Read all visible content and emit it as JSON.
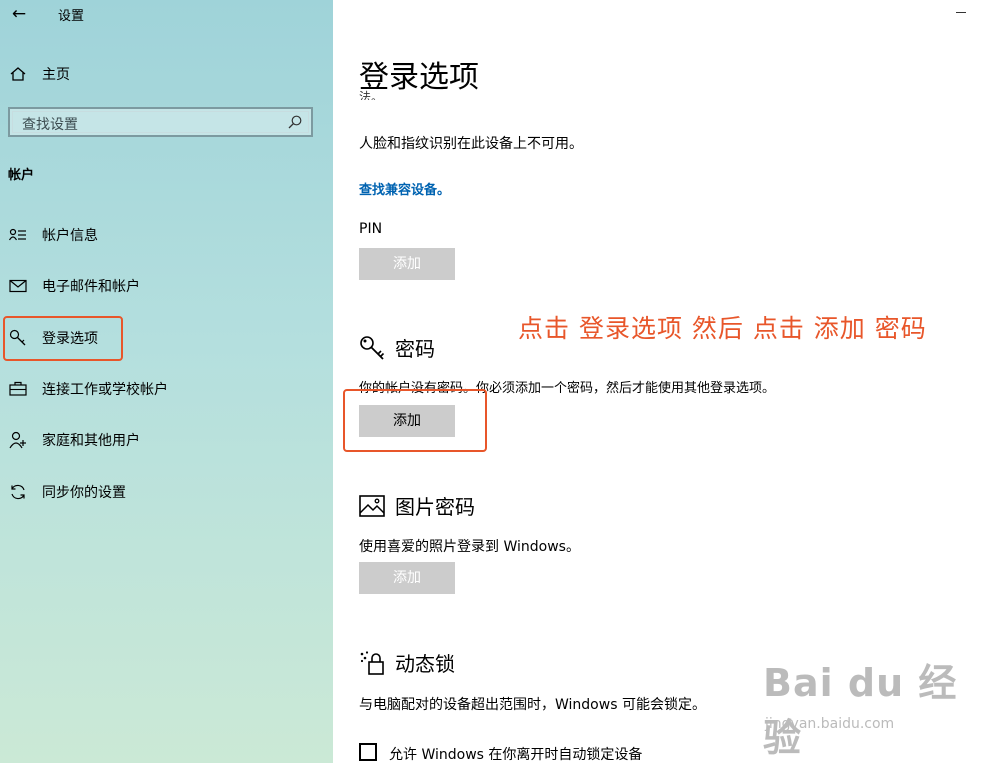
{
  "titlebar": {
    "back_glyph": "←",
    "title": "设置"
  },
  "sidebar": {
    "home_label": "主页",
    "search_placeholder": "查找设置",
    "section_label": "帐户",
    "items": [
      {
        "label": "帐户信息",
        "icon": "account-info-icon"
      },
      {
        "label": "电子邮件和帐户",
        "icon": "mail-icon"
      },
      {
        "label": "登录选项",
        "icon": "key-icon",
        "selected": true
      },
      {
        "label": "连接工作或学校帐户",
        "icon": "briefcase-icon"
      },
      {
        "label": "家庭和其他用户",
        "icon": "person-add-icon"
      },
      {
        "label": "同步你的设置",
        "icon": "sync-icon"
      }
    ]
  },
  "main": {
    "title": "登录选项",
    "clipped_text": "法。",
    "face_text": "人脸和指纹识别在此设备上不可用。",
    "compat_link": "查找兼容设备。",
    "pin_label": "PIN",
    "pin_button": "添加",
    "password_heading": "密码",
    "password_desc": "你的帐户没有密码。你必须添加一个密码，然后才能使用其他登录选项。",
    "password_button": "添加",
    "picture_heading": "图片密码",
    "picture_desc": "使用喜爱的照片登录到 Windows。",
    "picture_button": "添加",
    "dynamic_heading": "动态锁",
    "dynamic_desc": "与电脑配对的设备超出范围时，Windows 可能会锁定。",
    "dynamic_checkbox": "允许 Windows 在你离开时自动锁定设备"
  },
  "annotation": "点击 登录选项 然后 点击 添加 密码",
  "watermark": {
    "logo_text": "Bai du 经验",
    "url": "jingyan.baidu.com"
  },
  "colors": {
    "accent_link": "#0063b1",
    "annotation": "#e8562a",
    "disabled_button": "#cccccc"
  }
}
